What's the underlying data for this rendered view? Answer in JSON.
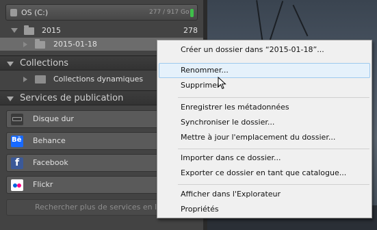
{
  "volume": {
    "name": "OS (C:)",
    "capacity": "277 / 917 Go"
  },
  "folders": {
    "year": {
      "name": "2015",
      "count": "278"
    },
    "day": {
      "name": "2015-01-18"
    }
  },
  "collections": {
    "title": "Collections",
    "item": "Collections dynamiques"
  },
  "publish": {
    "title": "Services de publication",
    "services": [
      {
        "label": "Disque dur",
        "icon": "hard-drive-icon",
        "cut": "C"
      },
      {
        "label": "Behance",
        "icon": "behance-icon",
        "cut": "C",
        "icon_text": "Bē"
      },
      {
        "label": "Facebook",
        "icon": "facebook-icon",
        "cut": "C",
        "icon_text": "f"
      },
      {
        "label": "Flickr",
        "icon": "flickr-icon",
        "cut": "C"
      }
    ],
    "more": "Rechercher plus de services en lig"
  },
  "context_menu": {
    "items": [
      {
        "label": "Créer un dossier dans “2015-01-18”..."
      },
      {
        "label": "Renommer..."
      },
      {
        "label": "Supprimer"
      },
      {
        "label": "Enregistrer les métadonnées"
      },
      {
        "label": "Synchroniser le dossier..."
      },
      {
        "label": "Mettre à jour l'emplacement du dossier..."
      },
      {
        "label": "Importer dans ce dossier..."
      },
      {
        "label": "Exporter ce dossier en tant que catalogue..."
      },
      {
        "label": "Afficher dans l'Explorateur"
      },
      {
        "label": "Propriétés"
      }
    ],
    "highlighted": "Renommer..."
  },
  "colors": {
    "accent_led": "#3fbf4a",
    "menu_highlight": "#e5f1fb",
    "behance": "#1769ff",
    "facebook": "#3b5998",
    "flickr_blue": "#0063dc",
    "flickr_pink": "#ff0084"
  }
}
